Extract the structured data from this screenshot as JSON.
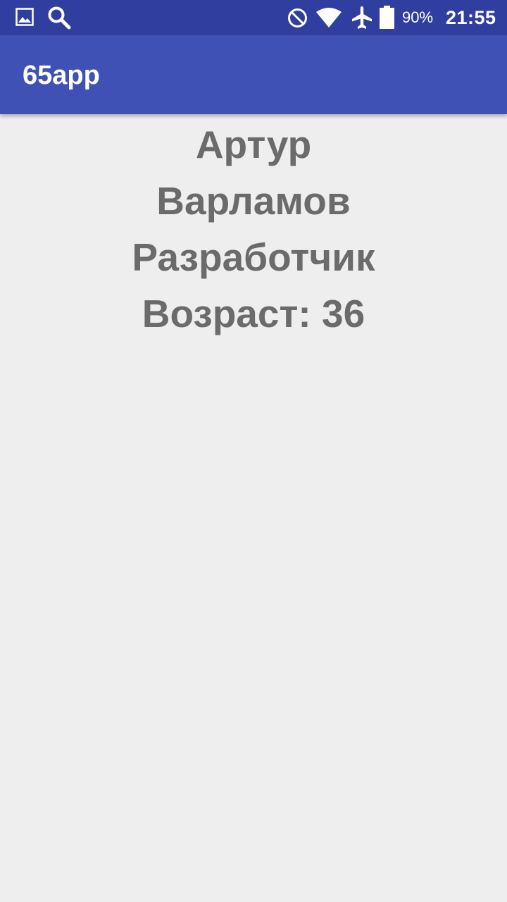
{
  "status_bar": {
    "icons": [
      "image-icon",
      "search-icon",
      "do-not-disturb-icon",
      "wifi-icon",
      "airplane-icon",
      "battery-icon"
    ],
    "battery_percent": "90%",
    "time": "21:55",
    "color": "#303f9f"
  },
  "app_bar": {
    "title": "65app",
    "color": "#3f51b5"
  },
  "profile": {
    "first_name": "Артур",
    "last_name": "Варламов",
    "position": "Разработчик",
    "age": "Возраст: 36"
  }
}
